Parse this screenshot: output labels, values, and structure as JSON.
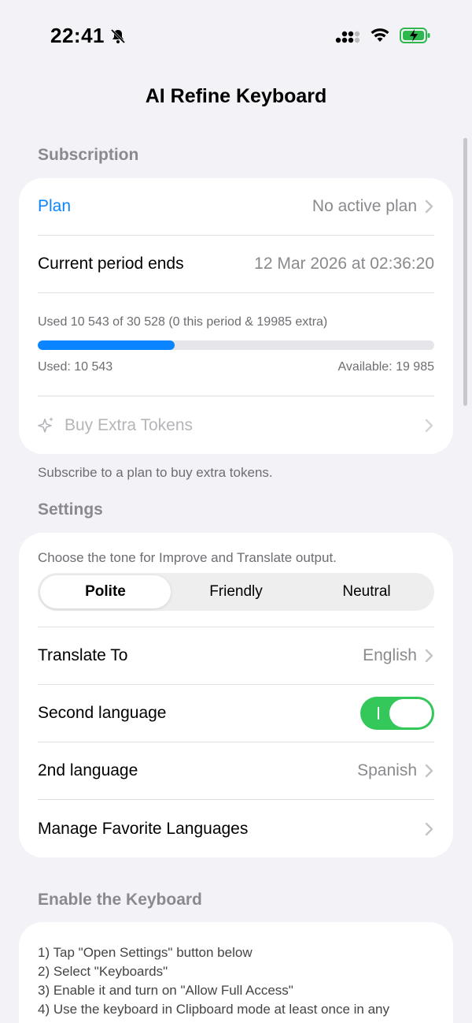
{
  "status_bar": {
    "time": "22:41",
    "icons": [
      "bell-slash-icon",
      "signal-icon",
      "wifi-icon",
      "battery-charging-icon"
    ]
  },
  "nav": {
    "title": "AI Refine Keyboard"
  },
  "subscription": {
    "header": "Subscription",
    "plan_label": "Plan",
    "plan_value": "No active plan",
    "period_label": "Current period ends",
    "period_value": "12 Mar 2026 at 02:36:20",
    "usage_summary": "Used 10 543 of 30 528 (0 this period & 19985 extra)",
    "usage_fraction": 0.345,
    "used_text": "Used: 10 543",
    "available_text": "Available: 19 985",
    "buy_label": "Buy Extra Tokens",
    "footer": "Subscribe to a plan to buy extra tokens."
  },
  "settings": {
    "header": "Settings",
    "tone_caption": "Choose the tone for Improve and Translate output.",
    "tones": [
      "Polite",
      "Friendly",
      "Neutral"
    ],
    "selected_tone": "Polite",
    "translate_label": "Translate To",
    "translate_value": "English",
    "second_lang_label": "Second language",
    "second_lang_toggle": true,
    "second_lang_value_label": "2nd language",
    "second_lang_value": "Spanish",
    "favorites_label": "Manage Favorite Languages"
  },
  "enable": {
    "header": "Enable the Keyboard",
    "steps": [
      "1) Tap \"Open Settings\" button below",
      "2) Select \"Keyboards\"",
      "3) Enable it and turn on \"Allow Full Access\"",
      "4) Use the keyboard in Clipboard mode at least once in any"
    ]
  },
  "colors": {
    "accent": "#0a84ff",
    "toggle_on": "#34c759",
    "background": "#f2f2f7"
  }
}
